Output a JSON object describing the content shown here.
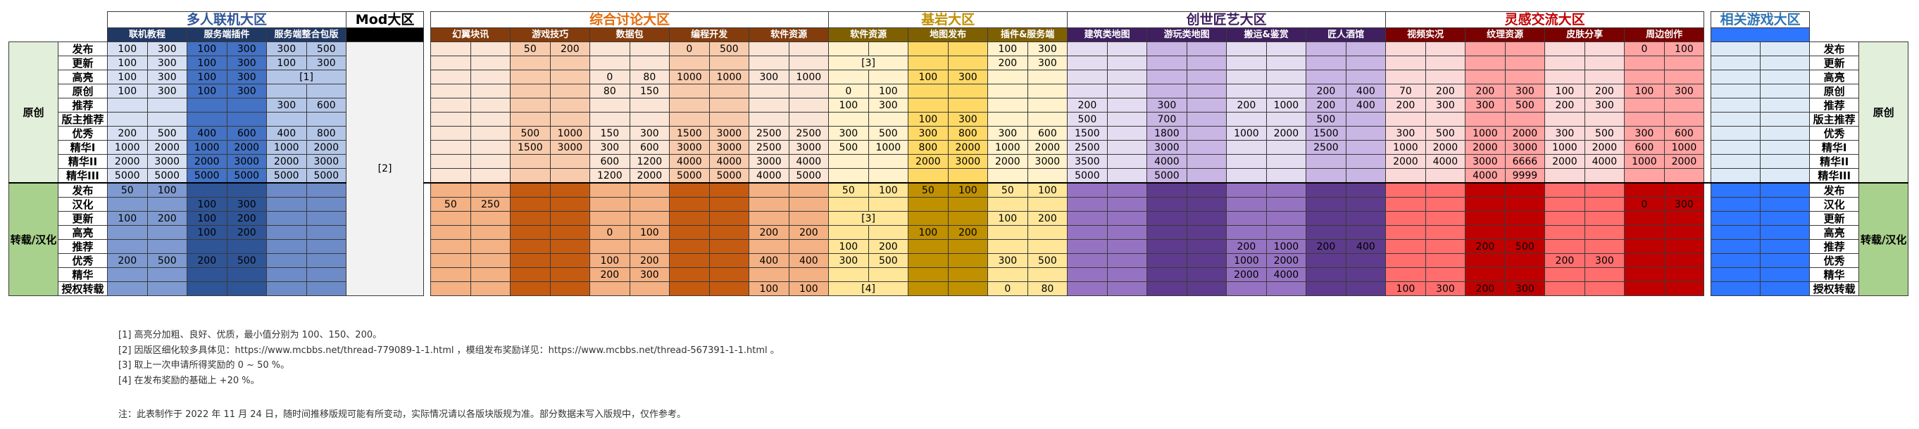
{
  "sections": [
    {
      "id": "multi",
      "title": "多人联机大区",
      "color": "#2f5597",
      "headBg": "#fff",
      "subBg": "#203864",
      "subColor": "#fff",
      "cols": [
        {
          "name": "联机教程",
          "b": "#d6e0f2",
          "t": "#7e9ad0"
        },
        {
          "name": "服务端插件",
          "b": "#4472c4",
          "t": "#2f5597"
        },
        {
          "name": "服务端整合包版",
          "b": "#b4c6e7",
          "t": "#6d8bc7"
        }
      ]
    },
    {
      "id": "mod",
      "title": "Mod大区",
      "color": "#000",
      "headBg": "#fff",
      "subBg": "#000",
      "subColor": "#fff",
      "cols": [
        {
          "name": "",
          "b": "#f2f2f2",
          "t": "#f2f2f2"
        }
      ]
    },
    {
      "id": "general",
      "title": "综合讨论大区",
      "color": "#e46c0a",
      "headBg": "#fff",
      "subBg": "#843c0c",
      "subColor": "#fff",
      "cols": [
        {
          "name": "幻翼块讯",
          "b": "#fbe5d6",
          "t": "#f4b183"
        },
        {
          "name": "游戏技巧",
          "b": "#f8cbad",
          "t": "#c55a11"
        },
        {
          "name": "数据包",
          "b": "#fbe5d6",
          "t": "#f4b183"
        },
        {
          "name": "编程开发",
          "b": "#f8cbad",
          "t": "#c55a11"
        },
        {
          "name": "软件资源",
          "b": "#fbe5d6",
          "t": "#f4b183"
        }
      ]
    },
    {
      "id": "bedrock",
      "title": "基岩大区",
      "color": "#bf9000",
      "headBg": "#fff",
      "subBg": "#7f6000",
      "subColor": "#fff",
      "cols": [
        {
          "name": "软件资源",
          "b": "#fff2cc",
          "t": "#ffe699"
        },
        {
          "name": "地图发布",
          "b": "#ffd966",
          "t": "#bf9000"
        },
        {
          "name": "插件&服务端",
          "b": "#fff2cc",
          "t": "#ffe699"
        }
      ]
    },
    {
      "id": "creation",
      "title": "创世匠艺大区",
      "color": "#3f1f5f",
      "headBg": "#fff",
      "subBg": "#3f1f5f",
      "subColor": "#fff",
      "cols": [
        {
          "name": "建筑类地图",
          "b": "#e4dcf0",
          "t": "#9673c2"
        },
        {
          "name": "游玩类地图",
          "b": "#c9b6e4",
          "t": "#5e3b8c"
        },
        {
          "name": "搬运&鉴赏",
          "b": "#e4dcf0",
          "t": "#9673c2"
        },
        {
          "name": "匠人酒馆",
          "b": "#c9b6e4",
          "t": "#5e3b8c"
        }
      ]
    },
    {
      "id": "inspire",
      "title": "灵感交流大区",
      "color": "#c00000",
      "headBg": "#fff",
      "subBg": "#7b0000",
      "subColor": "#fff",
      "cols": [
        {
          "name": "视频实况",
          "b": "#fcd9d9",
          "t": "#ff6d6d"
        },
        {
          "name": "纹理资源",
          "b": "#ffa3a3",
          "t": "#c00000"
        },
        {
          "name": "皮肤分享",
          "b": "#fcd9d9",
          "t": "#ff6d6d"
        },
        {
          "name": "周边创作",
          "b": "#ffa3a3",
          "t": "#c00000"
        }
      ]
    },
    {
      "id": "related",
      "title": "相关游戏大区",
      "color": "#2e75b6",
      "headBg": "#fff",
      "subBg": "#2e75ff",
      "subColor": "#fff",
      "cols": [
        {
          "name": "",
          "b": "#deebf7",
          "t": "#2e75ff"
        }
      ]
    }
  ],
  "groups": [
    {
      "label": "原创",
      "bg": "#e2efda",
      "rows": [
        "发布",
        "更新",
        "高亮",
        "原创",
        "推荐",
        "版主推荐",
        "优秀",
        "精华I",
        "精华II",
        "精华III"
      ]
    },
    {
      "label": "转载/汉化",
      "bg": "#a9d18e",
      "rows": [
        "发布",
        "汉化",
        "更新",
        "高亮",
        "推荐",
        "优秀",
        "精华",
        "授权转载"
      ]
    }
  ],
  "mod_note": "[2]",
  "rows": [
    [
      [
        "100",
        "300"
      ],
      [
        "100",
        "300"
      ],
      [
        "300",
        "500"
      ],
      "",
      [
        "50",
        "200"
      ],
      "",
      [
        "0",
        "500"
      ],
      "",
      "",
      "",
      [
        "100",
        "300"
      ],
      "",
      "",
      "",
      "",
      "",
      "",
      "",
      [
        "0",
        "100"
      ]
    ],
    [
      [
        "100",
        "300"
      ],
      [
        "100",
        "300"
      ],
      [
        "100",
        "300"
      ],
      "",
      "",
      "",
      "",
      "",
      [
        "[3]"
      ],
      "",
      [
        "200",
        "300"
      ],
      "",
      "",
      "",
      "",
      "",
      "",
      "",
      ""
    ],
    [
      [
        "100",
        "300"
      ],
      [
        "100",
        "300"
      ],
      [
        "[1]"
      ],
      "",
      "",
      [
        "0",
        "80"
      ],
      [
        "1000",
        "1000"
      ],
      [
        "300",
        "1000"
      ],
      "",
      [
        "100",
        "300"
      ],
      "",
      "",
      "",
      "",
      "",
      "",
      "",
      "",
      ""
    ],
    [
      [
        "100",
        "300"
      ],
      [
        "100",
        "300"
      ],
      "",
      "",
      "",
      [
        "80",
        "150"
      ],
      "",
      "",
      [
        "0",
        "100"
      ],
      "",
      "",
      "",
      "",
      "",
      [
        "200",
        "400"
      ],
      [
        "70",
        "200"
      ],
      [
        "200",
        "300"
      ],
      [
        "100",
        "200"
      ],
      [
        "100",
        "300"
      ]
    ],
    [
      "",
      "",
      [
        "300",
        "600"
      ],
      "",
      "",
      "",
      "",
      "",
      [
        "100",
        "300"
      ],
      "",
      "",
      [
        "200",
        ""
      ],
      [
        "300",
        ""
      ],
      [
        "200",
        "1000"
      ],
      [
        "200",
        "400"
      ],
      [
        "200",
        "300"
      ],
      [
        "300",
        "500"
      ],
      [
        "200",
        "300"
      ],
      ""
    ],
    [
      "",
      "",
      "",
      "",
      "",
      "",
      "",
      "",
      "",
      [
        "100",
        "300"
      ],
      "",
      [
        "500",
        ""
      ],
      [
        "700",
        ""
      ],
      "",
      [
        "500",
        ""
      ],
      "",
      "",
      "",
      ""
    ],
    [
      [
        "200",
        "500"
      ],
      [
        "400",
        "600"
      ],
      [
        "400",
        "800"
      ],
      "",
      [
        "500",
        "1000"
      ],
      [
        "150",
        "300"
      ],
      [
        "1500",
        "3000"
      ],
      [
        "2500",
        "2500"
      ],
      [
        "300",
        "500"
      ],
      [
        "300",
        "800"
      ],
      [
        "300",
        "600"
      ],
      [
        "1500",
        ""
      ],
      [
        "1800",
        ""
      ],
      [
        "1000",
        "2000"
      ],
      [
        "1500",
        ""
      ],
      [
        "300",
        "500"
      ],
      [
        "1000",
        "2000"
      ],
      [
        "300",
        "500"
      ],
      [
        "300",
        "600"
      ]
    ],
    [
      [
        "1000",
        "2000"
      ],
      [
        "1000",
        "2000"
      ],
      [
        "1000",
        "2000"
      ],
      "",
      [
        "1500",
        "3000"
      ],
      [
        "300",
        "600"
      ],
      [
        "3000",
        "3000"
      ],
      [
        "2500",
        "3000"
      ],
      [
        "500",
        "1000"
      ],
      [
        "800",
        "2000"
      ],
      [
        "1000",
        "2000"
      ],
      [
        "2500",
        ""
      ],
      [
        "3000",
        ""
      ],
      "",
      [
        "2500",
        ""
      ],
      [
        "1000",
        "2000"
      ],
      [
        "2000",
        "3000"
      ],
      [
        "1000",
        "2000"
      ],
      [
        "600",
        "1000"
      ]
    ],
    [
      [
        "2000",
        "3000"
      ],
      [
        "2000",
        "3000"
      ],
      [
        "2000",
        "3000"
      ],
      "",
      "",
      [
        "600",
        "1200"
      ],
      [
        "4000",
        "4000"
      ],
      [
        "3000",
        "4000"
      ],
      "",
      [
        "2000",
        "3000"
      ],
      [
        "2000",
        "3000"
      ],
      [
        "3500",
        ""
      ],
      [
        "4000",
        ""
      ],
      "",
      "",
      [
        "2000",
        "4000"
      ],
      [
        "3000",
        "6666"
      ],
      [
        "2000",
        "4000"
      ],
      [
        "1000",
        "2000"
      ]
    ],
    [
      [
        "5000",
        "5000"
      ],
      [
        "5000",
        "5000"
      ],
      [
        "5000",
        "5000"
      ],
      "",
      "",
      [
        "1200",
        "2000"
      ],
      [
        "5000",
        "5000"
      ],
      [
        "4000",
        "5000"
      ],
      "",
      "",
      "",
      [
        "5000",
        ""
      ],
      [
        "5000",
        ""
      ],
      "",
      "",
      "",
      [
        "4000",
        "9999"
      ],
      "",
      ""
    ],
    [
      [
        "50",
        "100"
      ],
      "",
      "",
      "",
      "",
      "",
      "",
      "",
      [
        "50",
        "100"
      ],
      [
        "50",
        "100"
      ],
      [
        "50",
        "100"
      ],
      "",
      "",
      "",
      "",
      "",
      "",
      "",
      ""
    ],
    [
      "",
      [
        "100",
        "300"
      ],
      "",
      [
        "50",
        "250"
      ],
      "",
      "",
      "",
      "",
      "",
      "",
      "",
      "",
      "",
      "",
      "",
      "",
      "",
      "",
      [
        "0",
        "300"
      ]
    ],
    [
      [
        "100",
        "200"
      ],
      [
        "100",
        "200"
      ],
      "",
      "",
      "",
      "",
      "",
      "",
      [
        "[3]"
      ],
      "",
      [
        "100",
        "200"
      ],
      "",
      "",
      "",
      "",
      "",
      "",
      "",
      ""
    ],
    [
      "",
      [
        "100",
        "200"
      ],
      "",
      "",
      "",
      [
        "0",
        "100"
      ],
      "",
      [
        "200",
        "200"
      ],
      "",
      [
        "100",
        "200"
      ],
      "",
      "",
      "",
      "",
      "",
      "",
      "",
      "",
      ""
    ],
    [
      "",
      "",
      "",
      "",
      "",
      "",
      "",
      "",
      [
        "100",
        "200"
      ],
      "",
      "",
      "",
      "",
      [
        "200",
        "1000"
      ],
      [
        "200",
        "400"
      ],
      "",
      [
        "200",
        "500"
      ],
      "",
      ""
    ],
    [
      [
        "200",
        "500"
      ],
      [
        "200",
        "500"
      ],
      "",
      "",
      "",
      [
        "100",
        "200"
      ],
      "",
      [
        "400",
        "400"
      ],
      [
        "300",
        "500"
      ],
      "",
      [
        "300",
        "500"
      ],
      "",
      "",
      [
        "1000",
        "2000"
      ],
      "",
      "",
      "",
      [
        "200",
        "300"
      ],
      ""
    ],
    [
      "",
      "",
      "",
      "",
      "",
      [
        "200",
        "300"
      ],
      "",
      "",
      "",
      "",
      "",
      "",
      "",
      [
        "2000",
        "4000"
      ],
      "",
      "",
      "",
      "",
      ""
    ],
    [
      "",
      "",
      "",
      "",
      "",
      "",
      "",
      [
        "100",
        "100"
      ],
      [
        "[4]"
      ],
      "",
      [
        "0",
        "80"
      ],
      "",
      "",
      "",
      "",
      [
        "100",
        "300"
      ],
      [
        "200",
        "300"
      ],
      "",
      ""
    ]
  ],
  "footnotes": [
    "[1] 高亮分加粗、良好、优质，最小值分别为 100、150、200。",
    "[2] 因版区细化较多具体见：https://www.mcbbs.net/thread-779089-1-1.html ，模组发布奖励详见：https://www.mcbbs.net/thread-567391-1-1.html 。",
    "[3] 取上一次申请所得奖励的 0 ~ 50 %。",
    "[4] 在发布奖励的基础上 +20 %。"
  ],
  "note": "注：此表制作于 2022 年 11 月 24 日，随时间推移版规可能有所变动，实际情况请以各版块版规为准。部分数据未写入版规中，仅作参考。"
}
